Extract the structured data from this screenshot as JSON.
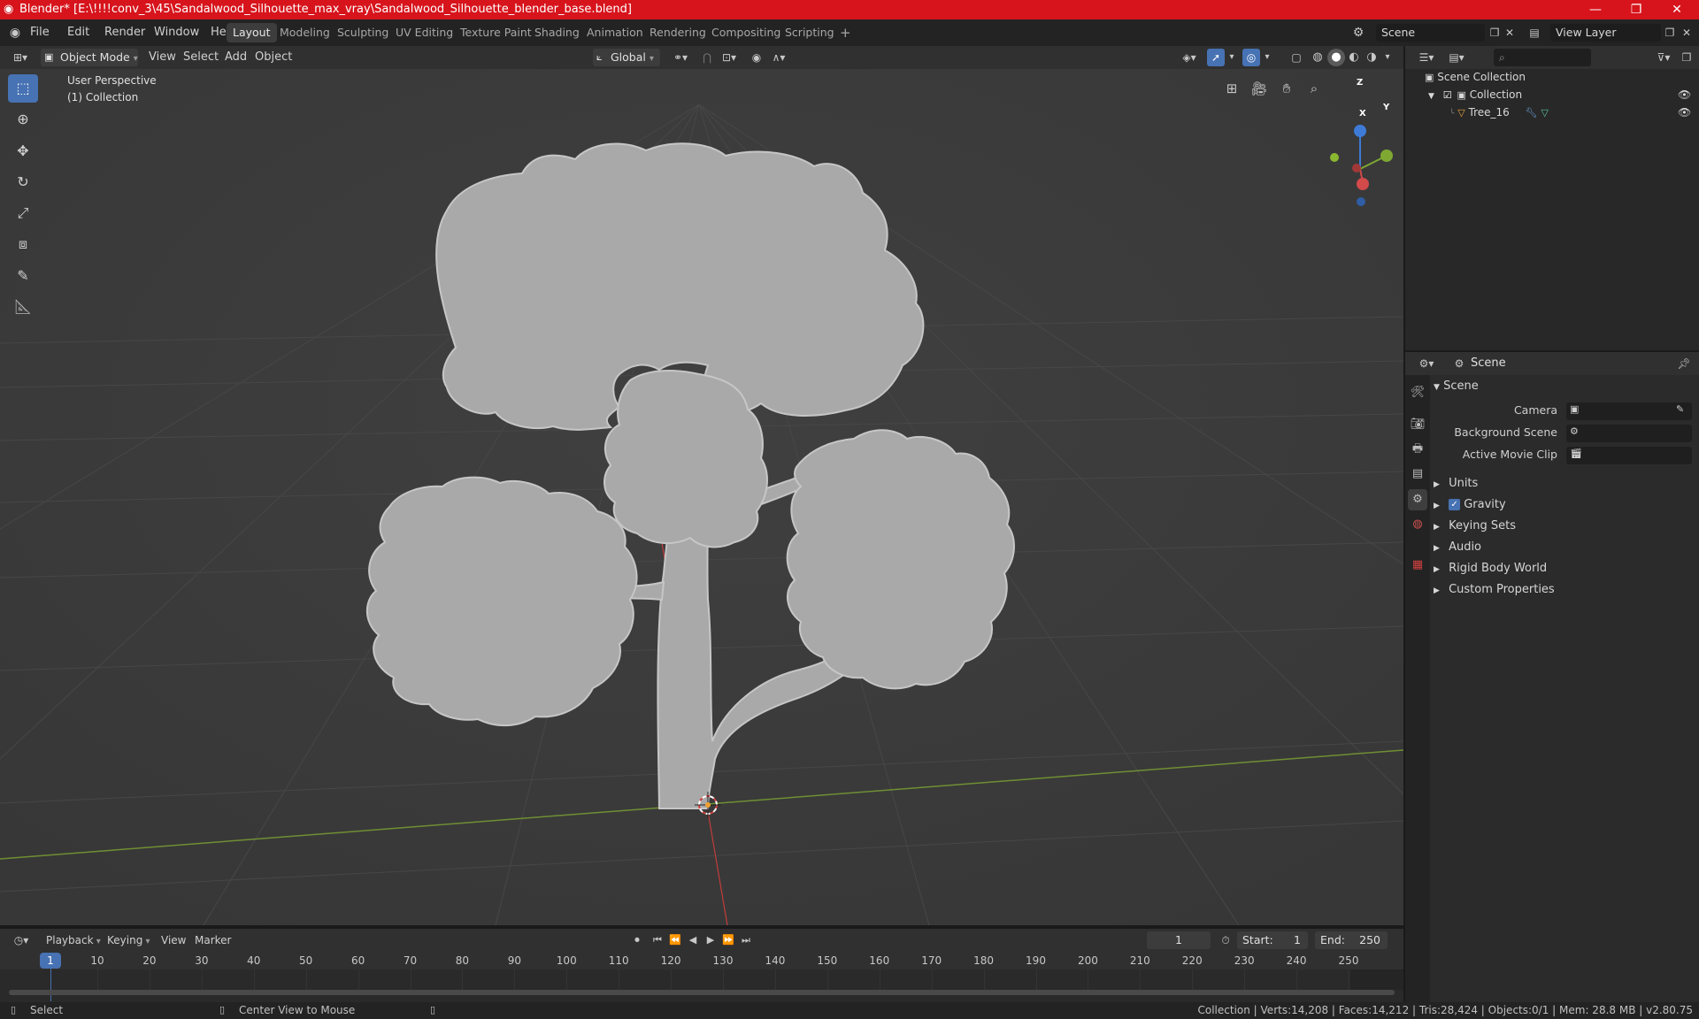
{
  "window": {
    "title": "Blender* [E:\\!!!!conv_3\\45\\Sandalwood_Silhouette_max_vray\\Sandalwood_Silhouette_blender_base.blend]",
    "minimize": "—",
    "maximize": "❐",
    "close": "✕"
  },
  "menu": [
    "File",
    "Edit",
    "Render",
    "Window",
    "Help"
  ],
  "workspaces": [
    "Layout",
    "Modeling",
    "Sculpting",
    "UV Editing",
    "Texture Paint",
    "Shading",
    "Animation",
    "Rendering",
    "Compositing",
    "Scripting"
  ],
  "active_workspace": "Layout",
  "add_workspace": "+",
  "scene_field": "Scene",
  "view_layer_field": "View Layer",
  "viewport_header": {
    "mode": "Object Mode",
    "menus": [
      "View",
      "Select",
      "Add",
      "Object"
    ],
    "orientation": "Global"
  },
  "viewport": {
    "perspective_label": "User Perspective",
    "collection_label": "(1) Collection",
    "gizmo": {
      "z": "Z",
      "y": "Y",
      "x": "X"
    }
  },
  "outliner": {
    "root": "Scene Collection",
    "collection": "Collection",
    "object": "Tree_16"
  },
  "properties": {
    "header": "Scene",
    "panel": "Scene",
    "fields": [
      {
        "label": "Camera"
      },
      {
        "label": "Background Scene"
      },
      {
        "label": "Active Movie Clip"
      }
    ],
    "sections": [
      "Units",
      "Gravity",
      "Keying Sets",
      "Audio",
      "Rigid Body World",
      "Custom Properties"
    ],
    "gravity_checked": true
  },
  "timeline": {
    "menus": [
      "Playback",
      "Keying",
      "View",
      "Marker"
    ],
    "current_frame": "1",
    "start_label": "Start:",
    "start_value": "1",
    "end_label": "End:",
    "end_value": "250",
    "ticks": [
      "1",
      "10",
      "20",
      "30",
      "40",
      "50",
      "60",
      "70",
      "80",
      "90",
      "100",
      "110",
      "120",
      "130",
      "140",
      "150",
      "160",
      "170",
      "180",
      "190",
      "200",
      "210",
      "220",
      "230",
      "240",
      "250"
    ]
  },
  "status": {
    "left": "Select",
    "middle": "Center View to Mouse",
    "right": "Collection | Verts:14,208 | Faces:14,212 | Tris:28,424 | Objects:0/1 | Mem: 28.8 MB | v2.80.75"
  },
  "colors": {
    "titlebar": "#d7141c",
    "accent": "#4772b3",
    "x_axis": "#d24a4a",
    "y_axis": "#7ea832",
    "z_axis": "#3e7bd6",
    "tree": "#a9a9a9"
  }
}
